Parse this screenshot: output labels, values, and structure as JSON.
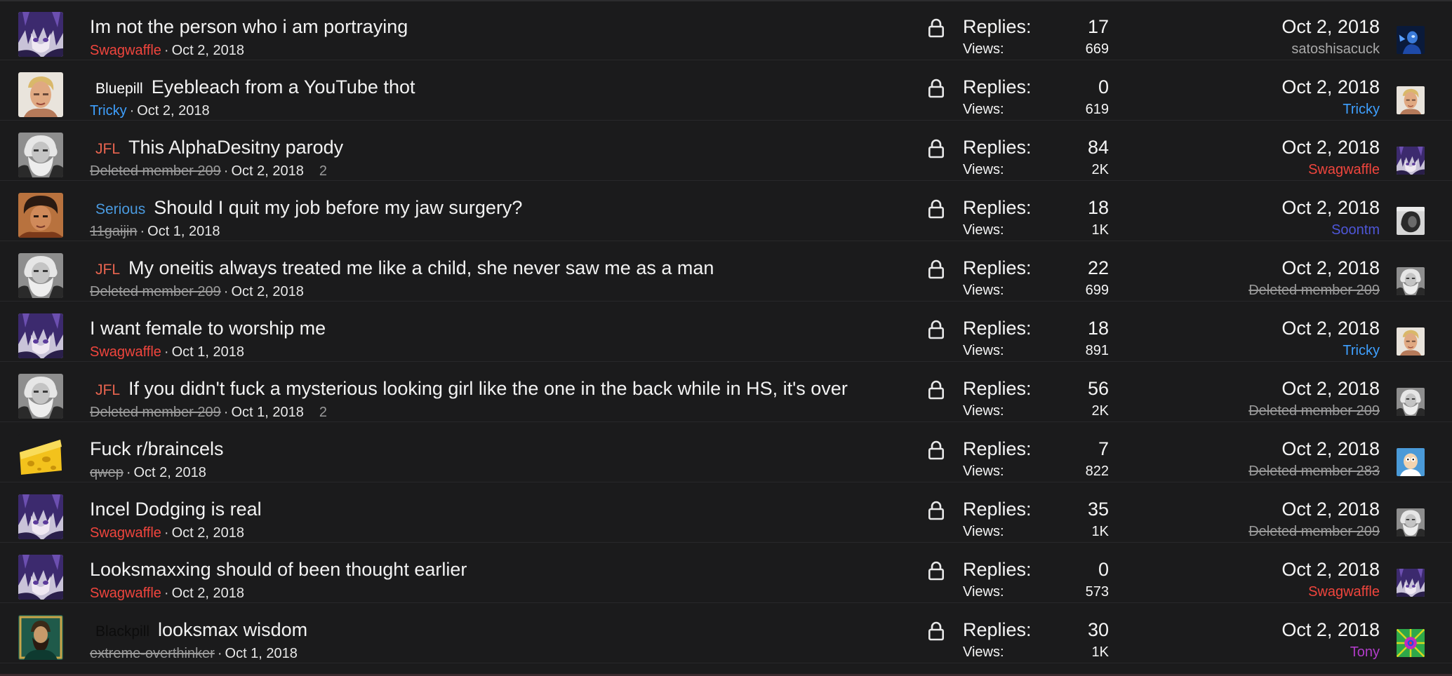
{
  "threads": [
    {
      "avatar": "anime-purple-hair-avatar",
      "prefix": "",
      "prefix_class": "",
      "title": "Im not the person who i am portraying",
      "author": "Swagwaffle",
      "author_class": "u-red",
      "date": "Oct 2, 2018",
      "pages": "",
      "replies_label": "Replies:",
      "replies": "17",
      "views_label": "Views:",
      "views": "669",
      "last_date": "Oct 2, 2018",
      "last_user": "satoshisacuck",
      "last_user_class": "u-grey",
      "last_avatar": "blue-figure-avatar"
    },
    {
      "avatar": "blond-man-avatar",
      "prefix": "Bluepill",
      "prefix_class": "bluepill",
      "title": "Eyebleach from a YouTube thot",
      "author": "Tricky",
      "author_class": "u-blue",
      "date": "Oct 2, 2018",
      "pages": "",
      "replies_label": "Replies:",
      "replies": "0",
      "views_label": "Views:",
      "views": "619",
      "last_date": "Oct 2, 2018",
      "last_user": "Tricky",
      "last_user_class": "u-blue",
      "last_avatar": "blond-man-avatar"
    },
    {
      "avatar": "bearded-man-grey-avatar",
      "prefix": "JFL",
      "prefix_class": "jfl",
      "title": "This AlphaDesitny parody",
      "author": "Deleted member 209",
      "author_class": "u-deleted",
      "date": "Oct 2, 2018",
      "pages": "2",
      "replies_label": "Replies:",
      "replies": "84",
      "views_label": "Views:",
      "views": "2K",
      "last_date": "Oct 2, 2018",
      "last_user": "Swagwaffle",
      "last_user_class": "u-red",
      "last_avatar": "anime-purple-hair-avatar"
    },
    {
      "avatar": "curly-hair-man-avatar",
      "prefix": "Serious",
      "prefix_class": "serious",
      "title": "Should I quit my job before my jaw surgery?",
      "author": "11gaijin",
      "author_class": "u-deleted",
      "date": "Oct 1, 2018",
      "pages": "",
      "replies_label": "Replies:",
      "replies": "18",
      "views_label": "Views:",
      "views": "1K",
      "last_date": "Oct 2, 2018",
      "last_user": "Soontm",
      "last_user_class": "u-indigo",
      "last_avatar": "dark-face-avatar"
    },
    {
      "avatar": "bearded-man-grey-avatar",
      "prefix": "JFL",
      "prefix_class": "jfl",
      "title": "My oneitis always treated me like a child, she never saw me as a man",
      "author": "Deleted member 209",
      "author_class": "u-deleted",
      "date": "Oct 2, 2018",
      "pages": "",
      "replies_label": "Replies:",
      "replies": "22",
      "views_label": "Views:",
      "views": "699",
      "last_date": "Oct 2, 2018",
      "last_user": "Deleted member 209",
      "last_user_class": "u-deleted",
      "last_avatar": "bearded-man-grey-avatar"
    },
    {
      "avatar": "anime-purple-hair-avatar",
      "prefix": "",
      "prefix_class": "",
      "title": "I want female to worship me",
      "author": "Swagwaffle",
      "author_class": "u-red",
      "date": "Oct 1, 2018",
      "pages": "",
      "replies_label": "Replies:",
      "replies": "18",
      "views_label": "Views:",
      "views": "891",
      "last_date": "Oct 2, 2018",
      "last_user": "Tricky",
      "last_user_class": "u-blue",
      "last_avatar": "blond-man-avatar"
    },
    {
      "avatar": "bearded-man-grey-avatar",
      "prefix": "JFL",
      "prefix_class": "jfl",
      "title": "If you didn't fuck a mysterious looking girl like the one in the back while in HS, it's over",
      "author": "Deleted member 209",
      "author_class": "u-deleted",
      "date": "Oct 1, 2018",
      "pages": "2",
      "replies_label": "Replies:",
      "replies": "56",
      "views_label": "Views:",
      "views": "2K",
      "last_date": "Oct 2, 2018",
      "last_user": "Deleted member 209",
      "last_user_class": "u-deleted",
      "last_avatar": "bearded-man-grey-avatar"
    },
    {
      "avatar": "cheese-avatar",
      "prefix": "",
      "prefix_class": "",
      "title": "Fuck r/braincels",
      "author": "qwep",
      "author_class": "u-deleted",
      "date": "Oct 2, 2018",
      "pages": "",
      "replies_label": "Replies:",
      "replies": "7",
      "views_label": "Views:",
      "views": "822",
      "last_date": "Oct 2, 2018",
      "last_user": "Deleted member 283",
      "last_user_class": "u-deleted",
      "last_avatar": "cartoon-man-avatar"
    },
    {
      "avatar": "anime-purple-hair-avatar",
      "prefix": "",
      "prefix_class": "",
      "title": "Incel Dodging is real",
      "author": "Swagwaffle",
      "author_class": "u-red",
      "date": "Oct 2, 2018",
      "pages": "",
      "replies_label": "Replies:",
      "replies": "35",
      "views_label": "Views:",
      "views": "1K",
      "last_date": "Oct 2, 2018",
      "last_user": "Deleted member 209",
      "last_user_class": "u-deleted",
      "last_avatar": "bearded-man-grey-avatar"
    },
    {
      "avatar": "anime-purple-hair-avatar",
      "prefix": "",
      "prefix_class": "",
      "title": "Looksmaxxing should of been thought earlier",
      "author": "Swagwaffle",
      "author_class": "u-red",
      "date": "Oct 2, 2018",
      "pages": "",
      "replies_label": "Replies:",
      "replies": "0",
      "views_label": "Views:",
      "views": "573",
      "last_date": "Oct 2, 2018",
      "last_user": "Swagwaffle",
      "last_user_class": "u-red",
      "last_avatar": "anime-purple-hair-avatar"
    },
    {
      "avatar": "ornate-portrait-avatar",
      "prefix": "Blackpill",
      "prefix_class": "blackpill",
      "title": "looksmax wisdom",
      "author": "extreme-overthinker",
      "author_class": "u-deleted",
      "date": "Oct 1, 2018",
      "pages": "",
      "replies_label": "Replies:",
      "replies": "30",
      "views_label": "Views:",
      "views": "1K",
      "last_date": "Oct 2, 2018",
      "last_user": "Tony",
      "last_user_class": "u-purple",
      "last_avatar": "psychedelic-avatar"
    }
  ],
  "meta_separator": "·",
  "icons": {
    "lock": "lock-icon"
  },
  "colors": {
    "background": "#1b1b1c",
    "username_red": "#f0453d",
    "username_blue": "#3fa0ff",
    "prefix_jfl": "#e8644f",
    "prefix_serious": "#4a9adf"
  }
}
